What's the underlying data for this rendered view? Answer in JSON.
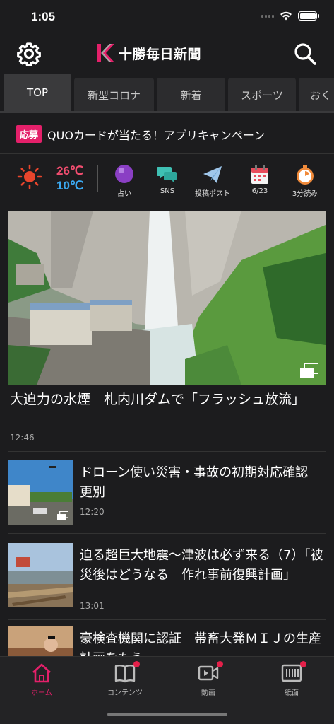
{
  "status": {
    "time": "1:05"
  },
  "header": {
    "logo_text": "十勝毎日新聞"
  },
  "tabs": [
    {
      "label": "TOP"
    },
    {
      "label": "新型コロナ"
    },
    {
      "label": "新着"
    },
    {
      "label": "スポーツ"
    },
    {
      "label": "おく"
    }
  ],
  "campaign": {
    "badge": "応募",
    "text": "QUOカードが当たる！アプリキャンペーン"
  },
  "weather": {
    "high": "26℃",
    "low": "10℃"
  },
  "quick": [
    {
      "label": "占い",
      "icon": "fortune-ball-icon"
    },
    {
      "label": "SNS",
      "icon": "chat-bubbles-icon"
    },
    {
      "label": "投稿ポスト",
      "icon": "paper-plane-icon"
    },
    {
      "label": "6/23",
      "icon": "calendar-icon"
    },
    {
      "label": "3分読み",
      "icon": "stopwatch-icon"
    }
  ],
  "hero": {
    "title": "大迫力の水煙　札内川ダムで「フラッシュ放流」",
    "time": "12:46"
  },
  "articles": [
    {
      "title": "ドローン使い災害・事故の初期対応確認　更別",
      "time": "12:20"
    },
    {
      "title": "迫る超巨大地震〜津波は必ず来る（7）「被災後はどうなる　作れ事前復興計画」",
      "time": "13:01"
    },
    {
      "title": "豪検査機関に認証　帯畜大発ＭＩＪの生産計画をもう",
      "time": ""
    }
  ],
  "nav": [
    {
      "label": "ホーム",
      "icon": "home-icon"
    },
    {
      "label": "コンテンツ",
      "icon": "book-icon"
    },
    {
      "label": "動画",
      "icon": "video-icon"
    },
    {
      "label": "紙面",
      "icon": "newspaper-icon"
    }
  ],
  "colors": {
    "accent": "#e4206a",
    "background": "#1c1c1e",
    "temp_high": "#f04d6f",
    "temp_low": "#3ba8f0"
  }
}
